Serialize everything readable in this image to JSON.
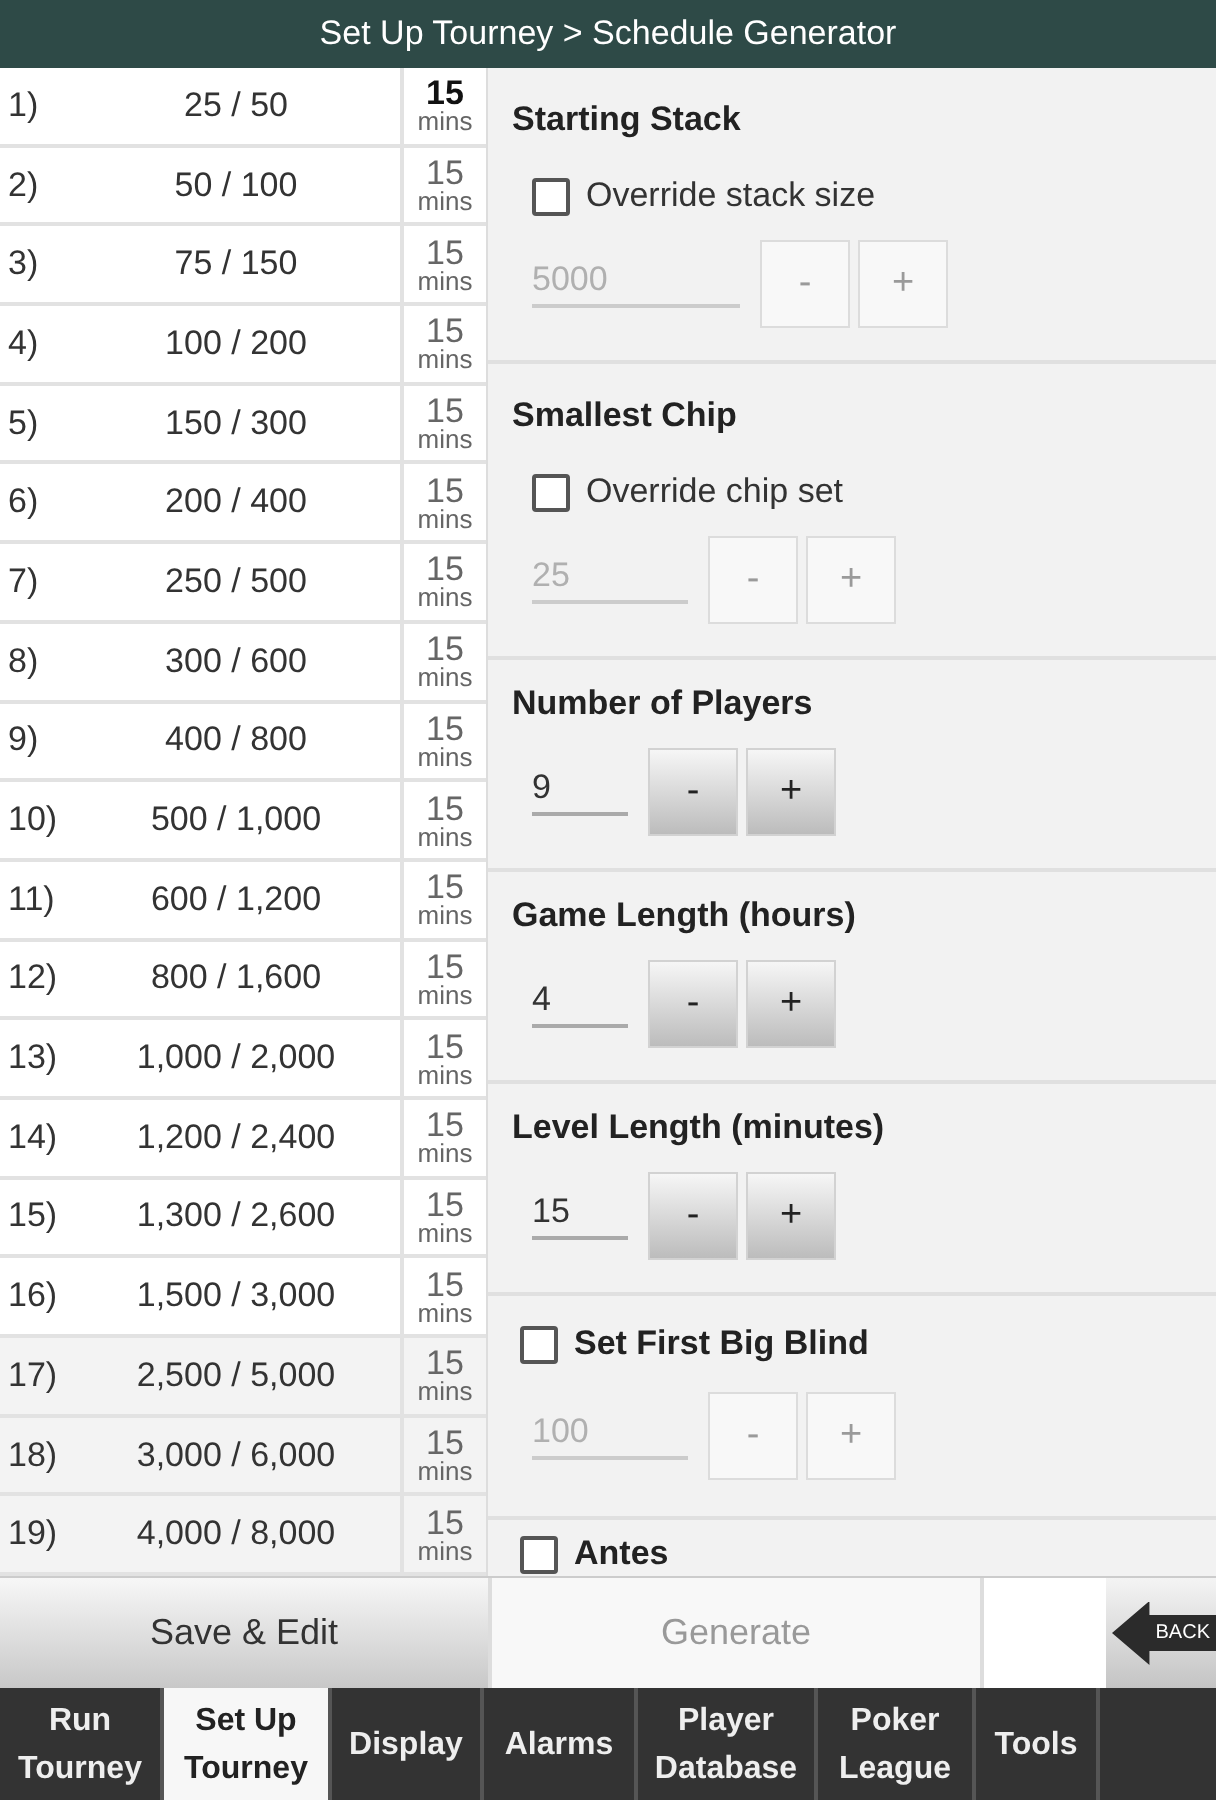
{
  "title_bar": {
    "title": "Set Up Tourney > Schedule Generator"
  },
  "levels": [
    {
      "number": "1)",
      "blinds": "25 / 50",
      "duration": "15",
      "unit": "mins",
      "current": true,
      "dimmed": false
    },
    {
      "number": "2)",
      "blinds": "50 / 100",
      "duration": "15",
      "unit": "mins",
      "current": false,
      "dimmed": false
    },
    {
      "number": "3)",
      "blinds": "75 / 150",
      "duration": "15",
      "unit": "mins",
      "current": false,
      "dimmed": false
    },
    {
      "number": "4)",
      "blinds": "100 / 200",
      "duration": "15",
      "unit": "mins",
      "current": false,
      "dimmed": false
    },
    {
      "number": "5)",
      "blinds": "150 / 300",
      "duration": "15",
      "unit": "mins",
      "current": false,
      "dimmed": false
    },
    {
      "number": "6)",
      "blinds": "200 / 400",
      "duration": "15",
      "unit": "mins",
      "current": false,
      "dimmed": false
    },
    {
      "number": "7)",
      "blinds": "250 / 500",
      "duration": "15",
      "unit": "mins",
      "current": false,
      "dimmed": false
    },
    {
      "number": "8)",
      "blinds": "300 / 600",
      "duration": "15",
      "unit": "mins",
      "current": false,
      "dimmed": false
    },
    {
      "number": "9)",
      "blinds": "400 / 800",
      "duration": "15",
      "unit": "mins",
      "current": false,
      "dimmed": false
    },
    {
      "number": "10)",
      "blinds": "500 / 1,000",
      "duration": "15",
      "unit": "mins",
      "current": false,
      "dimmed": false
    },
    {
      "number": "11)",
      "blinds": "600 / 1,200",
      "duration": "15",
      "unit": "mins",
      "current": false,
      "dimmed": false
    },
    {
      "number": "12)",
      "blinds": "800 / 1,600",
      "duration": "15",
      "unit": "mins",
      "current": false,
      "dimmed": false
    },
    {
      "number": "13)",
      "blinds": "1,000 / 2,000",
      "duration": "15",
      "unit": "mins",
      "current": false,
      "dimmed": false
    },
    {
      "number": "14)",
      "blinds": "1,200 / 2,400",
      "duration": "15",
      "unit": "mins",
      "current": false,
      "dimmed": false
    },
    {
      "number": "15)",
      "blinds": "1,300 / 2,600",
      "duration": "15",
      "unit": "mins",
      "current": false,
      "dimmed": false
    },
    {
      "number": "16)",
      "blinds": "1,500 / 3,000",
      "duration": "15",
      "unit": "mins",
      "current": false,
      "dimmed": false
    },
    {
      "number": "17)",
      "blinds": "2,500 / 5,000",
      "duration": "15",
      "unit": "mins",
      "current": false,
      "dimmed": true
    },
    {
      "number": "18)",
      "blinds": "3,000 / 6,000",
      "duration": "15",
      "unit": "mins",
      "current": false,
      "dimmed": true
    },
    {
      "number": "19)",
      "blinds": "4,000 / 8,000",
      "duration": "15",
      "unit": "mins",
      "current": false,
      "dimmed": true
    }
  ],
  "settings": [
    {
      "kind": "override",
      "heading": "Starting Stack",
      "checkbox": {
        "label": "Override stack size",
        "checked": false
      },
      "stepper": {
        "value": "5000",
        "disabled": true,
        "decrement": "-",
        "increment": "+"
      }
    },
    {
      "kind": "override",
      "heading": "Smallest Chip",
      "checkbox": {
        "label": "Override chip set",
        "checked": false
      },
      "stepper": {
        "value": "25",
        "disabled": true,
        "decrement": "-",
        "increment": "+"
      }
    },
    {
      "kind": "stepper",
      "heading": "Number of Players",
      "stepper": {
        "value": "9",
        "disabled": false,
        "decrement": "-",
        "increment": "+"
      }
    },
    {
      "kind": "stepper",
      "heading": "Game Length (hours)",
      "stepper": {
        "value": "4",
        "disabled": false,
        "decrement": "-",
        "increment": "+"
      }
    },
    {
      "kind": "stepper",
      "heading": "Level Length (minutes)",
      "stepper": {
        "value": "15",
        "disabled": false,
        "decrement": "-",
        "increment": "+"
      }
    },
    {
      "kind": "toggle",
      "checkbox": {
        "label": "Set First Big Blind",
        "checked": false
      },
      "stepper": {
        "value": "100",
        "disabled": true,
        "decrement": "-",
        "increment": "+"
      }
    },
    {
      "kind": "toggle",
      "checkbox": {
        "label": "Antes",
        "checked": false
      }
    }
  ],
  "action_bar": {
    "buttons": [
      {
        "label": "Save & Edit",
        "disabled": false
      },
      {
        "label": "Generate",
        "disabled": true
      }
    ],
    "back": {
      "label": "BACK"
    }
  },
  "tabs": [
    {
      "label": "Run Tourney",
      "selected": false
    },
    {
      "label": "Set Up Tourney",
      "selected": true
    },
    {
      "label": "Display",
      "selected": false
    },
    {
      "label": "Alarms",
      "selected": false
    },
    {
      "label": "Player Database",
      "selected": false
    },
    {
      "label": "Poker League",
      "selected": false
    },
    {
      "label": "Tools",
      "selected": false
    }
  ]
}
